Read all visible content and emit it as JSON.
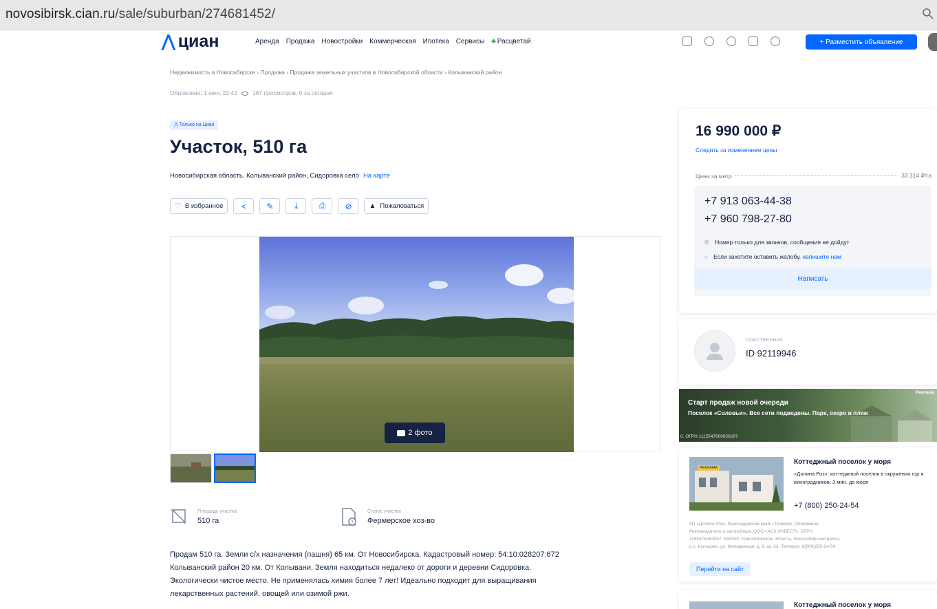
{
  "browser": {
    "url_host": "novosibirsk.cian.ru",
    "url_path": "/sale/suburban/274681452/"
  },
  "header": {
    "logo": "циан",
    "nav": [
      "Аренда",
      "Продажа",
      "Новостройки",
      "Коммерческая",
      "Ипотека",
      "Сервисы"
    ],
    "nav_special": "Расцветай",
    "post_button": "+ Разместить объявление",
    "accent_color": "#0468ff"
  },
  "breadcrumb": "Недвижимость в Новосибирске  ›  Продажа  ›  Продажа земельных участков в Новосибирской области  ›  Колыванский район",
  "meta": {
    "updated": "Обновлено: 1 июн, 22:42",
    "views": "167 просмотров, 0 за сегодня"
  },
  "badge": "Только на Циан",
  "title": "Участок, 510 га",
  "address": {
    "text": "Новосибирская область, Колыванский район, Сидоровка село",
    "map_link": "На карте"
  },
  "actions": {
    "favorite": "В избранное",
    "report": "Пожаловаться"
  },
  "gallery": {
    "photo_count": "2 фото"
  },
  "params": [
    {
      "label": "Площадь участка",
      "value": "510 га",
      "icon": "area-icon"
    },
    {
      "label": "Статус участка",
      "value": "Фермерское хоз-во",
      "icon": "document-status-icon"
    }
  ],
  "description": [
    "Продам 510 га. Земли с/х назначения (пашня) 65 км. От Новосибирска. Кадастровый номер: 54:10:028207:672",
    "Колыванский район 20 км. От Колывани. Земля находиться недалеко от дороги и деревни Сидоровка.",
    "Экологически чистое место. Не применялась химия более 7 лет! Идеально подходит для выращивания",
    "лекарственных растений, овощей или озимой ржи."
  ],
  "price_card": {
    "price": "16 990 000 ₽",
    "track": "Следить за изменением цены",
    "per_metre_label": "Цена за метр",
    "per_metre_value": "33 314 ₽/га",
    "phone1": "+7 913 063-44-38",
    "phone2": "+7 960 798-27-80",
    "note1": "Номер только для звонков, сообщения не дойдут",
    "note2": "Если захотите оставить жалобу,",
    "note2_link": "напишите нам",
    "write_button": "Написать"
  },
  "owner": {
    "type": "СОБСТВЕННИК",
    "id": "ID 92119946"
  },
  "banner": {
    "ad_label": "Реклама",
    "title": "Старт продаж новой очереди",
    "subtitle": "Поселок «Соловьи». Все сети подведены. Парк, озеро и пляж",
    "legal": "0. ОГРН 1115547600020297"
  },
  "ad_card": {
    "tag": "РЕКЛАМА",
    "title": "Коттеджный поселок у моря",
    "text": "«Долина Роз»: коттеджный поселок в окружении гор и виноградников, 3 мин. до моря",
    "phone": "+7 (800) 250-24-54",
    "legal": [
      "КП «Долина Роз», Краснодарский край, г.Северск. Оперимена",
      "Рекламодатель и застройщик: ООО «АСК ИНВЕСТ». ОГРН",
      "1165476084067. 630559, Новосибирская область, Новосибирский район,",
      "р.п. Кольцово, ул. Молодежная, д. 8, кв. 33. Телефон: 8(800)250-24-54"
    ],
    "link": "Перейти на сайт"
  },
  "ad_card2": {
    "title": "Коттеджный поселок у моря"
  }
}
